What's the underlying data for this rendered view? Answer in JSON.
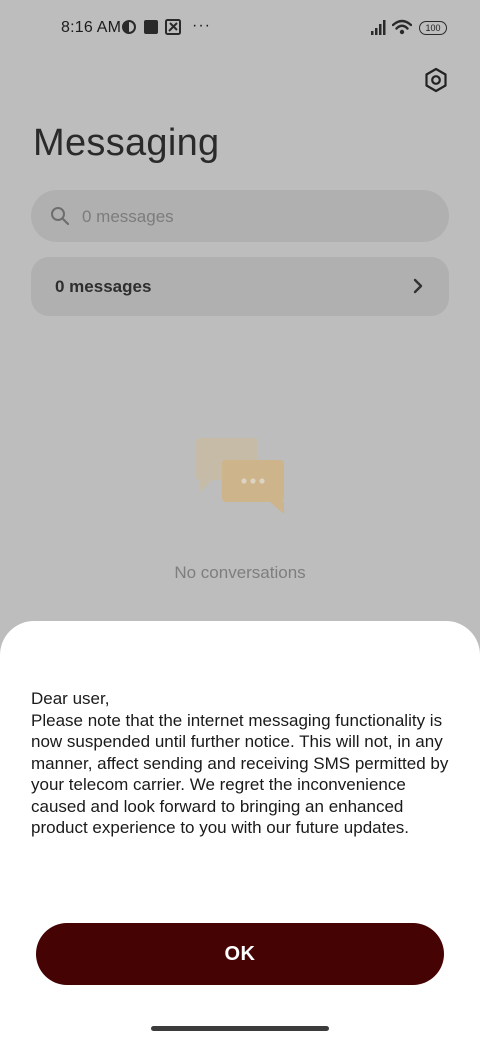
{
  "status_bar": {
    "time": "8:16 AM",
    "more_indicator": "···",
    "battery_level": "100"
  },
  "header": {
    "title": "Messaging"
  },
  "search": {
    "placeholder": "0 messages"
  },
  "messages_row": {
    "label": "0 messages"
  },
  "empty_state": {
    "text": "No conversations"
  },
  "dialog": {
    "message": "Dear user,\nPlease note that the internet messaging functionality is now suspended until further notice. This will not, in any manner, affect sending and receiving SMS permitted by your telecom carrier. We regret the inconvenience caused and look forward to bringing an enhanced product experience to you with our future updates.",
    "ok_label": "OK"
  },
  "colors": {
    "scrim_background": "#bdbdbd",
    "ok_button": "#450303",
    "empty_icon_accent": "#e8c98a"
  }
}
